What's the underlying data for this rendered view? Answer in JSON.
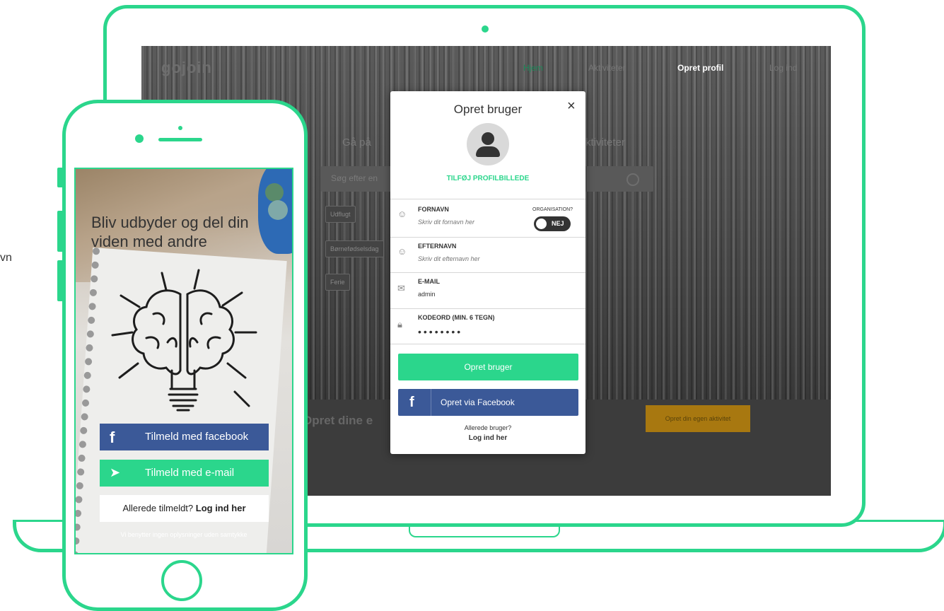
{
  "side_fragment": "vn",
  "laptop": {
    "logo": "gojoin",
    "nav": [
      "Hjem",
      "Aktiviteter",
      "Opret profil",
      "Log ind"
    ],
    "hero_left": "Gå på",
    "hero_right": "ktiviteter",
    "search_placeholder": "Søg efter en",
    "chips": [
      "Udflugt",
      "Børnefødselsdag",
      "Ferie"
    ],
    "bottom_text": "Opret dine e",
    "bottom_button": "Opret din egen aktivitet"
  },
  "modal": {
    "title": "Opret bruger",
    "close": "×",
    "add_photo": "TILFØJ PROFILBILLEDE",
    "firstname_label": "FORNAVN",
    "firstname_placeholder": "Skriv dit fornavn her",
    "organisation_label": "ORGANISATION?",
    "toggle_value": "NEJ",
    "lastname_label": "EFTERNAVN",
    "lastname_placeholder": "Skriv dit efternavn her",
    "email_label": "E-MAIL",
    "email_value": "admin",
    "password_label": "KODEORD (MIN. 6 TEGN)",
    "password_value": "••••••••",
    "create_button": "Opret bruger",
    "facebook_button": "Opret via Facebook",
    "facebook_icon": "f",
    "already": "Allerede bruger?",
    "login_link": "Log ind her"
  },
  "phone": {
    "headline": "Bliv udbyder og del din viden med andre",
    "fb_icon": "f",
    "fb_button": "Tilmeld med facebook",
    "mail_icon": "➤",
    "mail_button": "Tilmeld med e-mail",
    "already": "Allerede tilmeldt?",
    "login": "Log ind her",
    "fine_print": "Vi benytter ingen oplysninger uden samtykke"
  },
  "colors": {
    "accent": "#2bd68c",
    "facebook": "#3b5998",
    "dark": "#333333"
  }
}
